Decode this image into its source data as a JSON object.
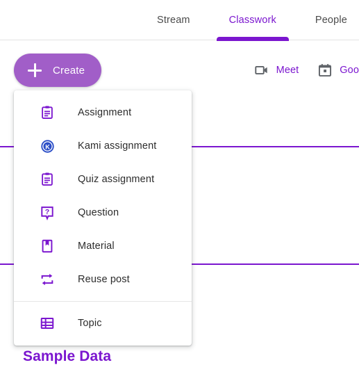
{
  "tabbar": {
    "tabs": [
      {
        "label": "Stream",
        "active": false
      },
      {
        "label": "Classwork",
        "active": true
      },
      {
        "label": "People",
        "active": false
      }
    ]
  },
  "actions": {
    "create_button": {
      "label": "Create",
      "icon": "plus-icon",
      "color": "#a15ec8"
    },
    "quick_links": [
      {
        "label": "Meet",
        "icon": "video-camera-icon"
      },
      {
        "label": "Goo",
        "icon": "calendar-icon"
      }
    ]
  },
  "create_menu": {
    "groups": [
      {
        "items": [
          {
            "label": "Assignment",
            "icon": "clipboard-icon"
          },
          {
            "label": "Kami assignment",
            "icon": "kami-logo-icon"
          },
          {
            "label": "Quiz assignment",
            "icon": "clipboard-icon"
          },
          {
            "label": "Question",
            "icon": "question-bubble-icon"
          },
          {
            "label": "Material",
            "icon": "book-icon"
          },
          {
            "label": "Reuse post",
            "icon": "swap-arrows-icon"
          }
        ]
      },
      {
        "items": [
          {
            "label": "Topic",
            "icon": "list-table-icon"
          }
        ]
      }
    ]
  },
  "page": {
    "heading": "Sample Data",
    "rules": 2
  },
  "colors": {
    "accent_purple": "#7b16cf",
    "button_purple": "#a15ec8",
    "kami_blue": "#2b4ec7",
    "icon_gray": "#5f6368",
    "text_dark": "#2c2c2c"
  }
}
